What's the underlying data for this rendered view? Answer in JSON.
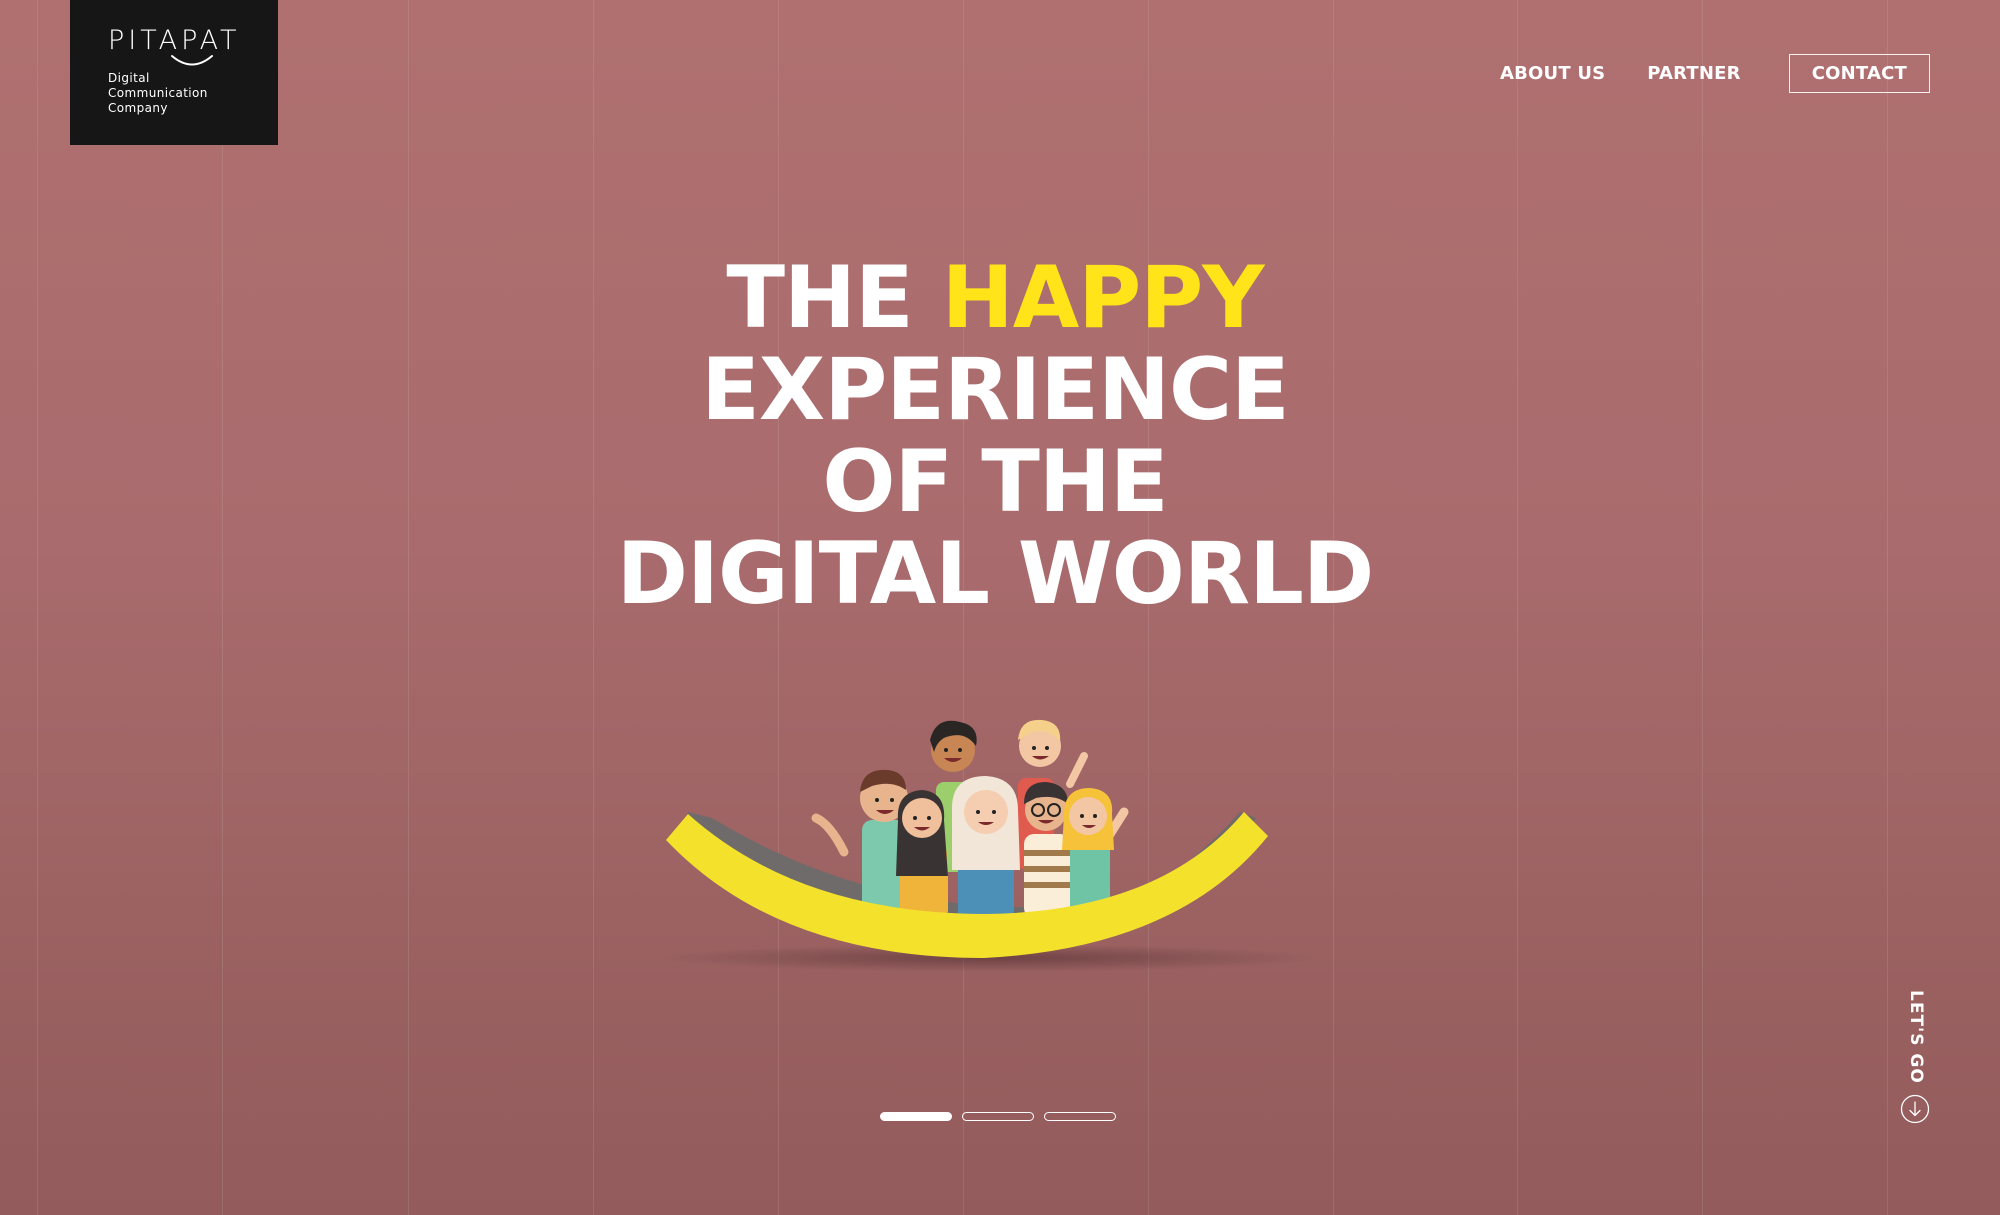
{
  "brand": {
    "name": "PITAPAT",
    "tagline_lines": [
      "Digital",
      "Communication",
      "Company"
    ]
  },
  "nav": {
    "about": "ABOUT US",
    "partner": "PARTNER",
    "contact": "CONTACT"
  },
  "hero": {
    "line1_plain": "THE ",
    "line1_accent": "HAPPY",
    "line2": "EXPERIENCE",
    "line3": "OF THE",
    "line4": "DIGITAL WORLD"
  },
  "slider": {
    "total": 3,
    "active_index": 0
  },
  "scroll_cue": {
    "label": "LET'S GO",
    "icon": "arrow-down-circle-icon"
  },
  "colors": {
    "background": "#a96b6d",
    "accent": "#ffe41a",
    "logo_bg": "#161616"
  }
}
